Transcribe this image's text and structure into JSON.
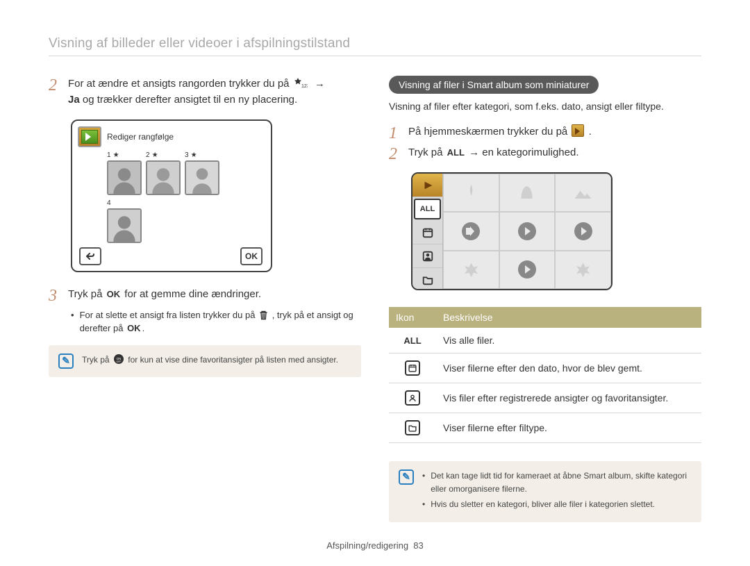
{
  "header": {
    "title": "Visning af billeder eller videoer i afspilningstilstand"
  },
  "left": {
    "step2_a": "For at ændre et ansigts rangorden trykker du på ",
    "step2_b": " og trækker derefter ansigtet til en ny placering.",
    "step2_bold": "Ja",
    "rank_title": "Rediger rangfølge",
    "rank_labels": [
      "1",
      "2",
      "3",
      "4"
    ],
    "btn_ok": "OK",
    "step3": "Tryk på   for at gemme dine ændringer.",
    "step3_a": "Tryk på ",
    "step3_b": " for at gemme dine ændringer.",
    "ok_token": "OK",
    "bullet_a": "For at slette et ansigt fra listen trykker du på ",
    "bullet_b": ", tryk på et ansigt og derefter på ",
    "note": "Tryk på     for kun at vise dine favoritansigter på listen med ansigter.",
    "note_a": "Tryk på ",
    "note_b": " for kun at vise dine favoritansigter på listen med ansigter."
  },
  "right": {
    "pill": "Visning af filer i Smart album som miniaturer",
    "sub": "Visning af filer efter kategori, som f.eks. dato, ansigt eller filtype.",
    "step1_a": "På hjemmeskærmen trykker du på ",
    "step1_b": ".",
    "step2_a": "Tryk på ",
    "step2_all": "ALL",
    "step2_b": " → en kategorimulighed.",
    "side_all": "ALL",
    "table": {
      "head": [
        "Ikon",
        "Beskrivelse"
      ],
      "rows": [
        {
          "icon": "ALL",
          "desc": "Vis alle filer."
        },
        {
          "icon": "calendar",
          "desc": "Viser filerne efter den dato, hvor de blev gemt."
        },
        {
          "icon": "person",
          "desc": "Vis filer efter registrerede ansigter og favoritansigter."
        },
        {
          "icon": "folder",
          "desc": "Viser filerne efter filtype."
        }
      ]
    },
    "note": [
      "Det kan tage lidt tid for kameraet at åbne Smart album, skifte kategori eller omorganisere filerne.",
      "Hvis du sletter en kategori, bliver alle filer i kategorien slettet."
    ]
  },
  "footer": {
    "section": "Afspilning/redigering",
    "page": "83"
  }
}
